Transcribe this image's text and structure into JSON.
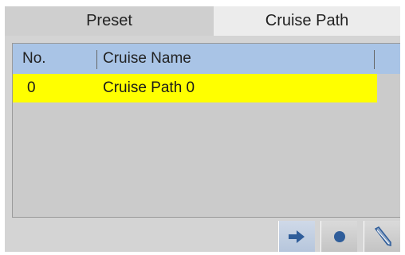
{
  "tabs": {
    "preset_label": "Preset",
    "cruise_path_label": "Cruise Path",
    "active": "Cruise Path"
  },
  "list": {
    "columns": [
      "No.",
      "Cruise Name"
    ],
    "rows": [
      {
        "no": "0",
        "name": "Cruise Path 0",
        "selected": true
      }
    ]
  },
  "toolbar": {
    "buttons": [
      {
        "icon": "arrow-right-icon"
      },
      {
        "icon": "record-dot-icon"
      },
      {
        "icon": "pencil-icon"
      }
    ]
  },
  "colors": {
    "selected_row": "#ffff00",
    "header": "#a9c4e6",
    "panel": "#d4d4d4",
    "icon": "#2f5d9a"
  }
}
